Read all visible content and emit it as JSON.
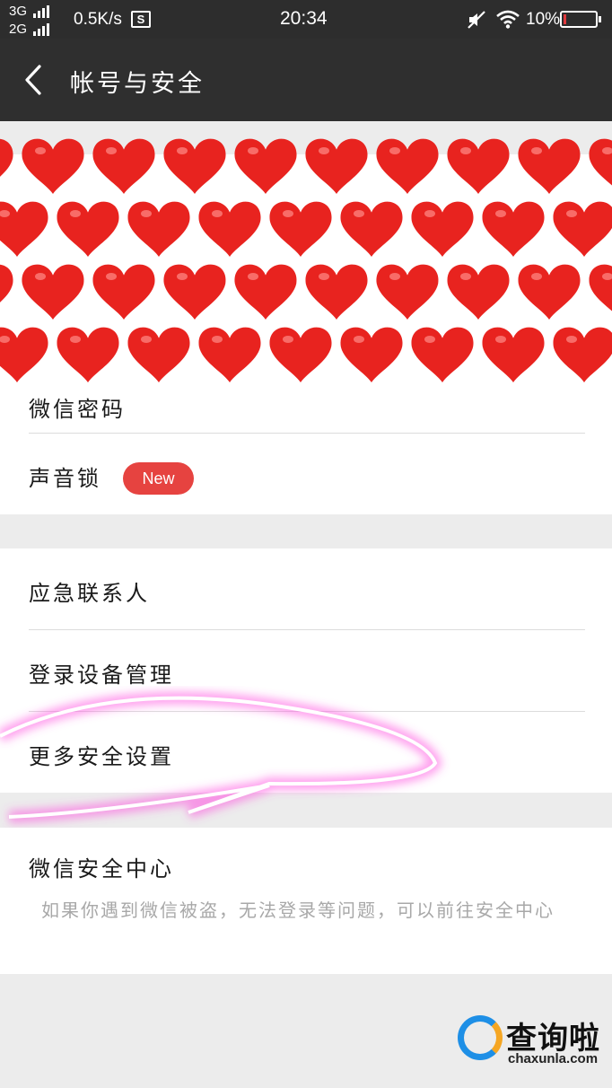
{
  "status_bar": {
    "signal_1": "3G",
    "signal_2": "2G",
    "net_speed": "0.5K/s",
    "s_icon_text": "S",
    "time": "20:34",
    "battery": "10%",
    "battery_level": 0.1,
    "battery_color": "#e0393e"
  },
  "header": {
    "back_icon": "chevron-left-icon",
    "title": "帐号与安全"
  },
  "group1": {
    "partial_row_label": "微信密码",
    "voice_lock_label": "声音锁",
    "new_badge": "New"
  },
  "group2": {
    "items": [
      {
        "label": "应急联系人"
      },
      {
        "label": "登录设备管理"
      },
      {
        "label": "更多安全设置"
      }
    ]
  },
  "group3": {
    "title": "微信安全中心",
    "description": "如果你遇到微信被盗，无法登录等问题，可以前往安全中心"
  },
  "watermark": {
    "main": "查询啦",
    "sub": "chaxunla.com"
  },
  "colors": {
    "accent_red": "#e64340",
    "header_bg": "#2f2f2f",
    "heart": "#e8231f",
    "scribble": "#ff4fe0"
  }
}
